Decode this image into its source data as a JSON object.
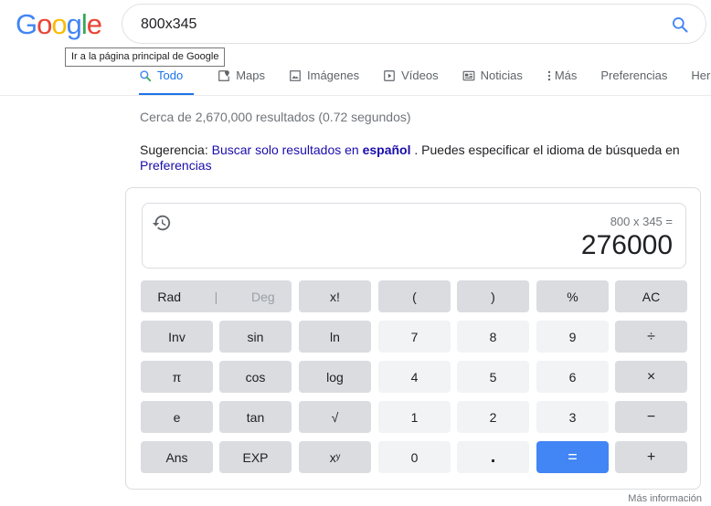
{
  "logo": {
    "letters": [
      "G",
      "o",
      "o",
      "g",
      "l",
      "e"
    ],
    "colors": [
      "#4285f4",
      "#ea4335",
      "#fbbc05",
      "#4285f4",
      "#34a853",
      "#ea4335"
    ]
  },
  "search": {
    "query": "800x345"
  },
  "tooltip": "Ir a la página principal de Google",
  "tabs": [
    {
      "label": "Todo",
      "icon": "search-icon",
      "active": true
    },
    {
      "label": "Maps",
      "icon": "map-icon"
    },
    {
      "label": "Imágenes",
      "icon": "image-icon"
    },
    {
      "label": "Vídeos",
      "icon": "video-icon"
    },
    {
      "label": "Noticias",
      "icon": "news-icon"
    },
    {
      "label": "Más",
      "icon": "more-vert-icon"
    },
    {
      "label": "Preferencias"
    },
    {
      "label": "Herram"
    }
  ],
  "stats": "Cerca de 2,670,000 resultados (0.72 segundos)",
  "suggestion": {
    "prefix": "Sugerencia:",
    "link_text": "Buscar solo resultados en",
    "link_bold": "español",
    "suffix": ". Puedes especificar el idioma de búsqueda en",
    "pref_link": "Preferencias"
  },
  "calculator": {
    "expression": "800 x 345 =",
    "result": "276000",
    "keys": {
      "rad": "Rad",
      "sep": "|",
      "deg": "Deg",
      "fact": "x!",
      "lparen": "(",
      "rparen": ")",
      "percent": "%",
      "ac": "AC",
      "inv": "Inv",
      "sin": "sin",
      "ln": "ln",
      "seven": "7",
      "eight": "8",
      "nine": "9",
      "divide": "÷",
      "pi": "π",
      "cos": "cos",
      "log": "log",
      "four": "4",
      "five": "5",
      "six": "6",
      "multiply": "×",
      "e": "e",
      "tan": "tan",
      "sqrt": "√",
      "one": "1",
      "two": "2",
      "three": "3",
      "minus": "−",
      "ans": "Ans",
      "exp": "EXP",
      "power": "xʸ",
      "zero": "0",
      "dot": ".",
      "equals": "=",
      "plus": "+"
    }
  },
  "more_info": "Más información"
}
